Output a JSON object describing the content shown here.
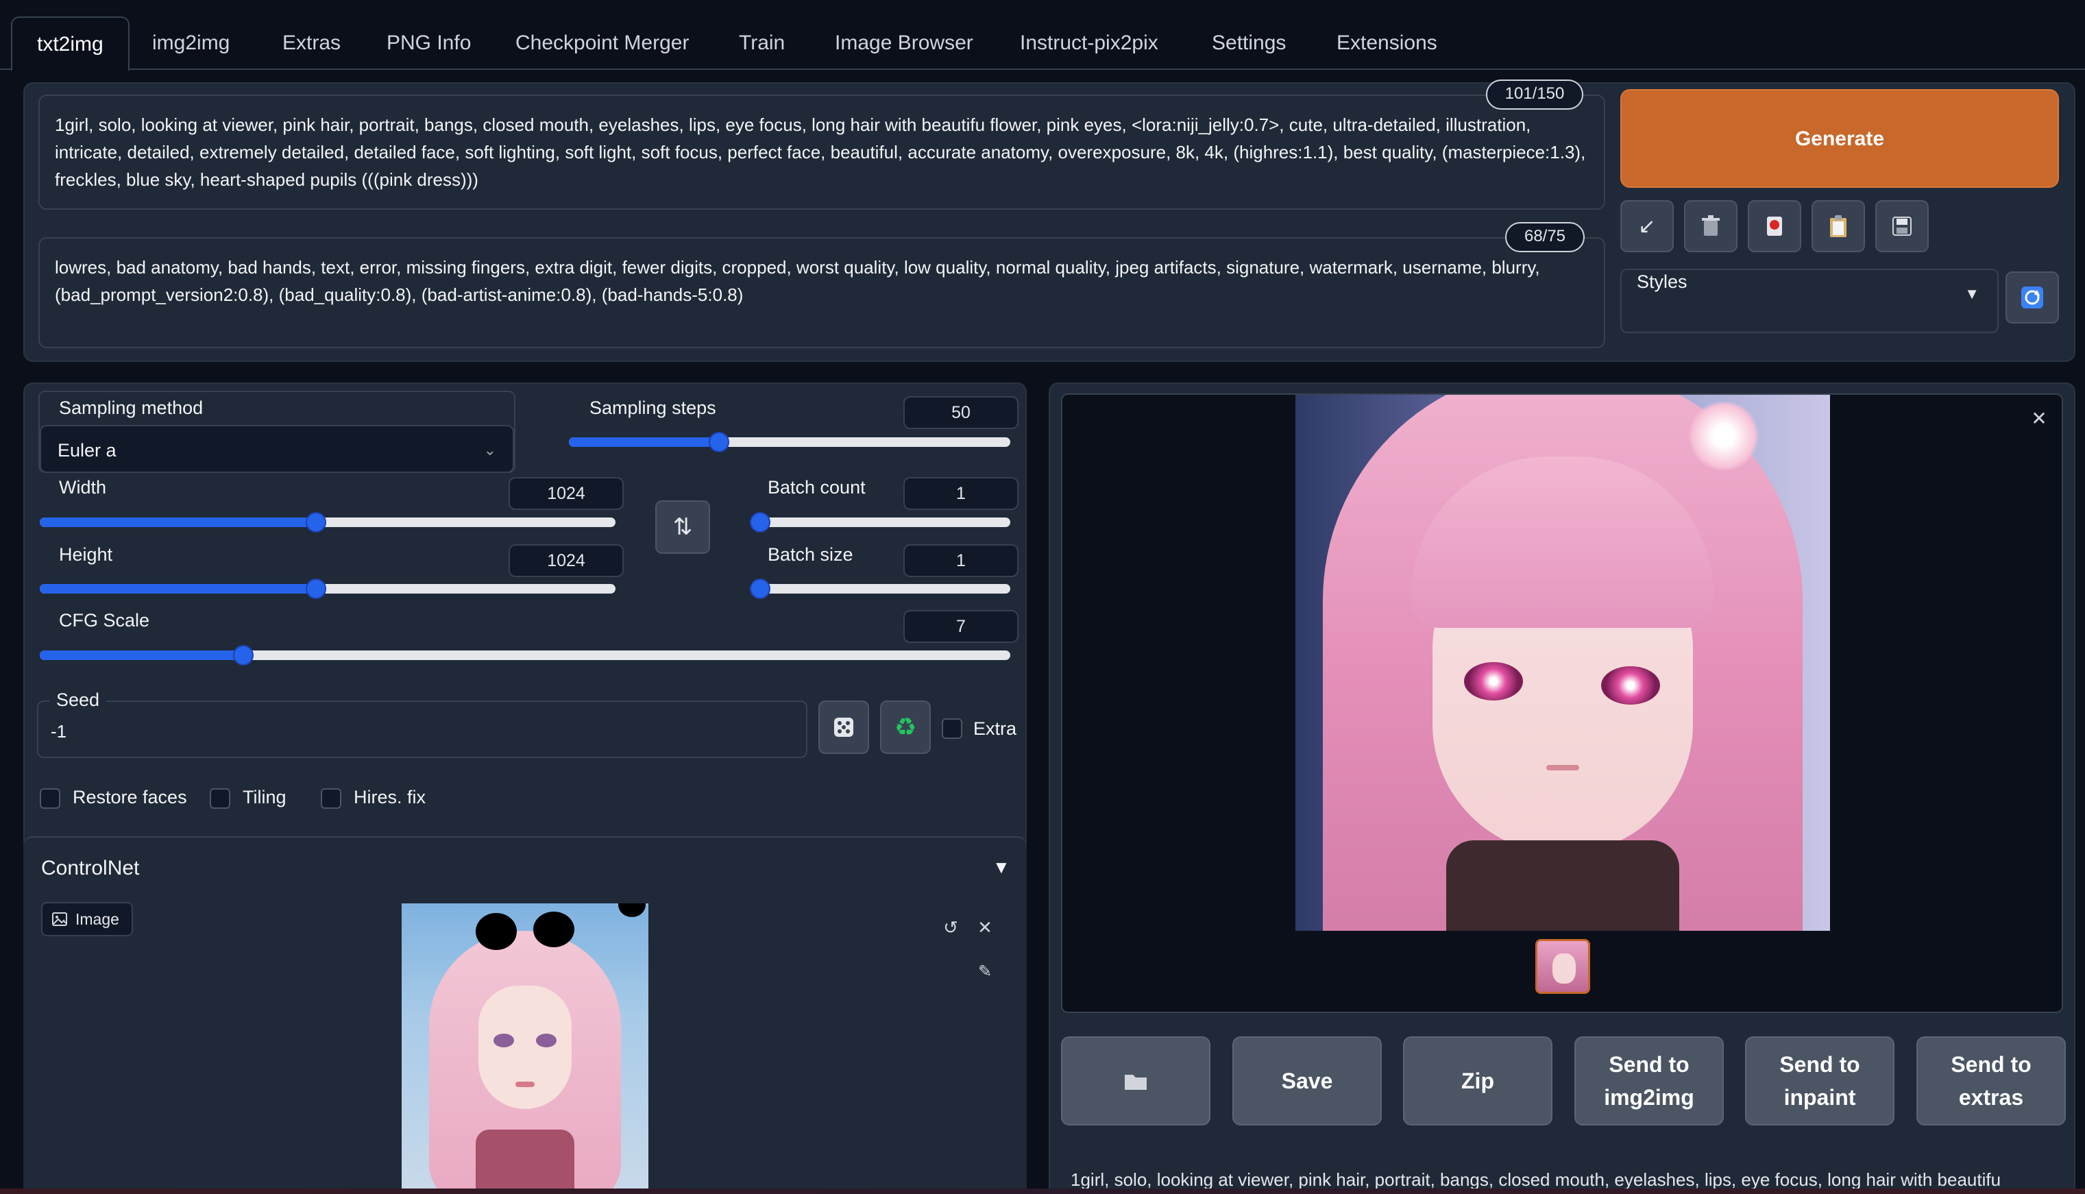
{
  "tabs": [
    "txt2img",
    "img2img",
    "Extras",
    "PNG Info",
    "Checkpoint Merger",
    "Train",
    "Image Browser",
    "Instruct-pix2pix",
    "Settings",
    "Extensions"
  ],
  "prompt": {
    "text": "1girl, solo, looking at viewer, pink hair, portrait, bangs, closed mouth, eyelashes, lips, eye focus, long hair with beautifu flower, pink eyes, <lora:niji_jelly:0.7>, cute, ultra-detailed, illustration, intricate, detailed, extremely detailed, detailed face, soft lighting, soft light, soft focus, perfect face, beautiful, accurate anatomy, overexposure, 8k, 4k, (highres:1.1), best quality, (masterpiece:1.3), freckles, blue sky, heart-shaped pupils (((pink dress)))",
    "counter": "101/150"
  },
  "negative_prompt": {
    "text": "lowres, bad anatomy, bad hands, text, error, missing fingers, extra digit, fewer digits, cropped, worst quality, low quality, normal quality, jpeg artifacts, signature, watermark, username, blurry, (bad_prompt_version2:0.8), (bad_quality:0.8), (bad-artist-anime:0.8), (bad-hands-5:0.8)",
    "counter": "68/75"
  },
  "generate_label": "Generate",
  "styles_label": "Styles",
  "sampling": {
    "method_label": "Sampling method",
    "method_value": "Euler a",
    "steps_label": "Sampling steps",
    "steps_value": "50",
    "steps_fraction": 0.34
  },
  "width": {
    "label": "Width",
    "value": "1024",
    "fraction": 0.48
  },
  "height": {
    "label": "Height",
    "value": "1024",
    "fraction": 0.48
  },
  "batch_count": {
    "label": "Batch count",
    "value": "1",
    "fraction": 0.0
  },
  "batch_size": {
    "label": "Batch size",
    "value": "1",
    "fraction": 0.0
  },
  "cfg": {
    "label": "CFG Scale",
    "value": "7",
    "fraction": 0.21
  },
  "seed": {
    "label": "Seed",
    "value": "-1",
    "extra_label": "Extra"
  },
  "checkboxes": {
    "restore_faces": "Restore faces",
    "tiling": "Tiling",
    "hires_fix": "Hires. fix"
  },
  "controlnet": {
    "title": "ControlNet",
    "image_tab": "Image"
  },
  "actions": {
    "save": "Save",
    "zip": "Zip",
    "send_img2img": [
      "Send to",
      "img2img"
    ],
    "send_inpaint": [
      "Send to",
      "inpaint"
    ],
    "send_extras": [
      "Send to",
      "extras"
    ]
  },
  "output_caption": "1girl, solo, looking at viewer, pink hair, portrait, bangs, closed mouth, eyelashes, lips, eye focus, long hair with beautifu",
  "colors": {
    "accent": "#2563eb",
    "generate": "#c8682a",
    "bg": "#0b0f19",
    "panel": "#1f2937"
  }
}
